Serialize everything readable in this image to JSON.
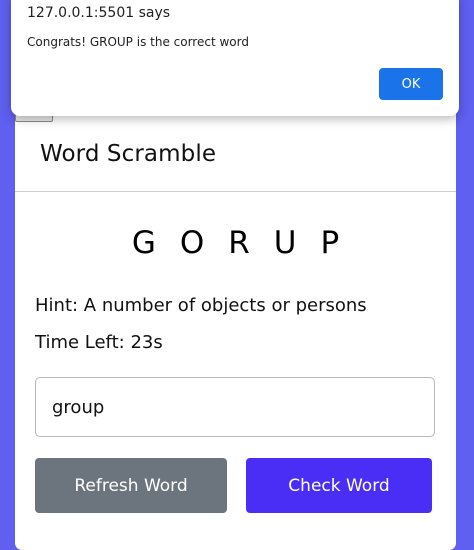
{
  "dialog": {
    "origin": "127.0.0.1:5501 says",
    "message": "Congrats! GROUP is the correct word",
    "ok_label": "OK"
  },
  "game": {
    "title": "Word Scramble",
    "scrambled_word": "GORUP",
    "hint_label": "Hint: ",
    "hint_text": "A number of objects or persons",
    "time_label": "Time Left: ",
    "time_value": "23s",
    "input_value": "group",
    "refresh_label": "Refresh Word",
    "check_label": "Check Word"
  },
  "colors": {
    "page_background": "#5f5ff0",
    "check_button": "#4a2ef5",
    "refresh_button": "#6c757d",
    "dialog_ok_button": "#1a73e8"
  }
}
